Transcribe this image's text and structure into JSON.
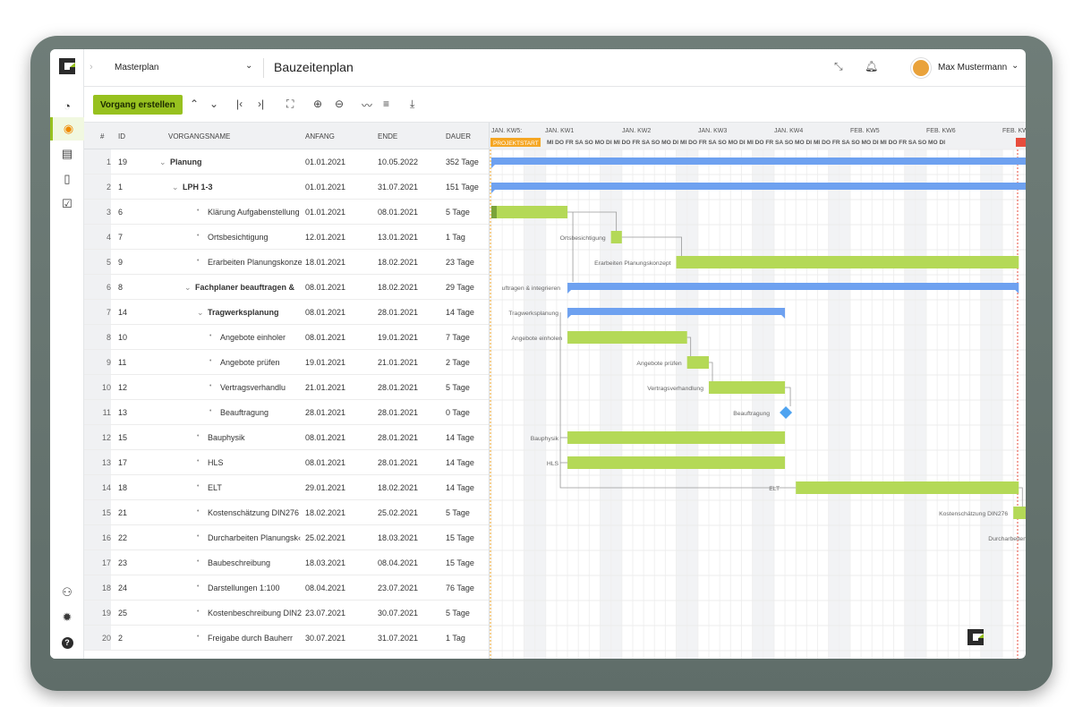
{
  "topbar": {
    "project": "Masterplan",
    "title": "Bauzeitenplan",
    "user": "Max Mustermann"
  },
  "toolbar": {
    "create_label": "Vorgang erstellen"
  },
  "columns": {
    "num": "#",
    "id": "ID",
    "name": "VORGANGSNAME",
    "start": "ANFANG",
    "end": "ENDE",
    "duration": "DAUER"
  },
  "rows": [
    {
      "num": "1",
      "id": "19",
      "name": "Planung",
      "start": "01.01.2021",
      "end": "10.05.2022",
      "duration": "352 Tage"
    },
    {
      "num": "2",
      "id": "1",
      "name": "LPH 1-3",
      "start": "01.01.2021",
      "end": "31.07.2021",
      "duration": "151 Tage"
    },
    {
      "num": "3",
      "id": "6",
      "name": "Klärung Aufgabenstellung",
      "start": "01.01.2021",
      "end": "08.01.2021",
      "duration": "5 Tage"
    },
    {
      "num": "4",
      "id": "7",
      "name": "Ortsbesichtigung",
      "start": "12.01.2021",
      "end": "13.01.2021",
      "duration": "1 Tag"
    },
    {
      "num": "5",
      "id": "9",
      "name": "Erarbeiten Planungskonze",
      "start": "18.01.2021",
      "end": "18.02.2021",
      "duration": "23 Tage"
    },
    {
      "num": "6",
      "id": "8",
      "name": "Fachplaner beauftragen &",
      "start": "08.01.2021",
      "end": "18.02.2021",
      "duration": "29 Tage"
    },
    {
      "num": "7",
      "id": "14",
      "name": "Tragwerksplanung",
      "start": "08.01.2021",
      "end": "28.01.2021",
      "duration": "14 Tage"
    },
    {
      "num": "8",
      "id": "10",
      "name": "Angebote einholer",
      "start": "08.01.2021",
      "end": "19.01.2021",
      "duration": "7 Tage"
    },
    {
      "num": "9",
      "id": "11",
      "name": "Angebote prüfen",
      "start": "19.01.2021",
      "end": "21.01.2021",
      "duration": "2 Tage"
    },
    {
      "num": "10",
      "id": "12",
      "name": "Vertragsverhandlu",
      "start": "21.01.2021",
      "end": "28.01.2021",
      "duration": "5 Tage"
    },
    {
      "num": "11",
      "id": "13",
      "name": "Beauftragung",
      "start": "28.01.2021",
      "end": "28.01.2021",
      "duration": "0 Tage"
    },
    {
      "num": "12",
      "id": "15",
      "name": "Bauphysik",
      "start": "08.01.2021",
      "end": "28.01.2021",
      "duration": "14 Tage"
    },
    {
      "num": "13",
      "id": "17",
      "name": "HLS",
      "start": "08.01.2021",
      "end": "28.01.2021",
      "duration": "14 Tage"
    },
    {
      "num": "14",
      "id": "18",
      "name": "ELT",
      "start": "29.01.2021",
      "end": "18.02.2021",
      "duration": "14 Tage"
    },
    {
      "num": "15",
      "id": "21",
      "name": "Kostenschätzung DIN276",
      "start": "18.02.2021",
      "end": "25.02.2021",
      "duration": "5 Tage"
    },
    {
      "num": "16",
      "id": "22",
      "name": "Durcharbeiten Planungsk‹",
      "start": "25.02.2021",
      "end": "18.03.2021",
      "duration": "15 Tage"
    },
    {
      "num": "17",
      "id": "23",
      "name": "Baubeschreibung",
      "start": "18.03.2021",
      "end": "08.04.2021",
      "duration": "15 Tage"
    },
    {
      "num": "18",
      "id": "24",
      "name": "Darstellungen 1:100",
      "start": "08.04.2021",
      "end": "23.07.2021",
      "duration": "76 Tage"
    },
    {
      "num": "19",
      "id": "25",
      "name": "Kostenbeschreibung DIN2",
      "start": "23.07.2021",
      "end": "30.07.2021",
      "duration": "5 Tage"
    },
    {
      "num": "20",
      "id": "2",
      "name": "Freigabe durch Bauherr",
      "start": "30.07.2021",
      "end": "31.07.2021",
      "duration": "1 Tag"
    }
  ],
  "gantt": {
    "weeks": [
      "JAN. KW5:",
      "JAN. KW1",
      "JAN. KW2",
      "JAN. KW3",
      "JAN. KW4",
      "FEB. KW5",
      "FEB. KW6",
      "FEB. KW"
    ],
    "day_row": "MI DO FR SA SO MO DI MI DO FR SA SO MO DI MI DO FR SA SO MO DI MI DO FR SA SO MO DI MI DO FR SA SO MO DI MI DO FR SA SO MO DI MI DO FR SA SO MO DI MI D",
    "start_marker": "PROJEKTSTART",
    "labels": {
      "ortsbesichtigung": "Ortsbesichtigung",
      "erarbeiten": "Erarbeiten Planungskonzept",
      "fachplaner": "uftragen & integrieren",
      "tragwerk": "Tragwerksplanung",
      "angebote_einholen": "Angebote einholen",
      "angebote_pruefen": "Angebote prüfen",
      "vertrag": "Vertragsverhandlung",
      "beauftragung": "Beauftragung",
      "bauphysik": "Bauphysik",
      "hls": "HLS",
      "elt": "ELT",
      "kosten": "Kostenschätzung DIN276",
      "durcharbeiten": "Durcharbeiten"
    }
  },
  "colors": {
    "green": "#97c11f",
    "bar_green": "#b4d957",
    "blue": "#6ea1f0",
    "diamond": "#4ea3f0",
    "orange": "#f5a623"
  }
}
